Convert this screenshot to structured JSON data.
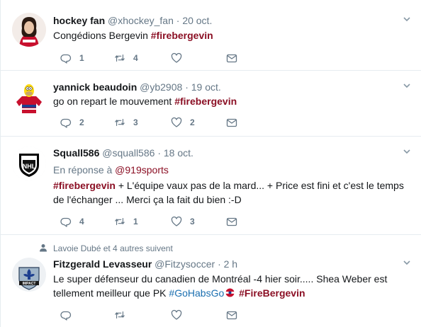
{
  "tweets": [
    {
      "fullname": "hockey fan",
      "handle": "@xhockey_fan",
      "dot": "·",
      "time": "20 oct.",
      "text_plain": "Congédions Bergevin ",
      "hashtag": "#firebergevin",
      "replies": "1",
      "retweets": "4",
      "likes": "",
      "avatar": "girl-in-habs-jersey"
    },
    {
      "fullname": "yannick beaudoin",
      "handle": "@yb2908",
      "dot": "·",
      "time": "19 oct.",
      "text_plain": "go on repart le mouvement ",
      "hashtag": "#firebergevin",
      "replies": "2",
      "retweets": "3",
      "likes": "2",
      "avatar": "homer-habs-jersey"
    },
    {
      "fullname": "Squall586",
      "handle": "@squall586",
      "dot": "·",
      "time": "18 oct.",
      "reply_prefix": "En réponse à ",
      "reply_mention": "@919sports",
      "hashtag": "#firebergevin",
      "text_after_tag": " + L'équipe vaux pas de la mard... + Price est fini et c'est le temps de l'échanger ... Merci ça la fait du bien :-D",
      "replies": "4",
      "retweets": "1",
      "likes": "3",
      "avatar": "nhl-logo"
    },
    {
      "context": "Lavoie Dubé et 4 autres suivent",
      "fullname": "Fitzgerald Levasseur",
      "handle": "@Fitzysoccer",
      "dot": "·",
      "time": "2 h",
      "text_plain": "Le super défenseur du canadien de Montréal -4 hier soir..... Shea Weber est tellement meilleur que PK ",
      "hashtag1": "#GoHabsGo",
      "hashtag2": "#FireBergevin",
      "replies": "",
      "retweets": "",
      "likes": "",
      "avatar": "impact-logo"
    }
  ],
  "icons": [
    "reply-icon",
    "retweet-icon",
    "like-icon",
    "dm-icon",
    "caret-down-icon",
    "person-icon",
    "habs-ball-emoji"
  ],
  "colors": {
    "hashtag": "#8b0f24",
    "secondary": "#657786",
    "divider": "#e6ecf0"
  }
}
